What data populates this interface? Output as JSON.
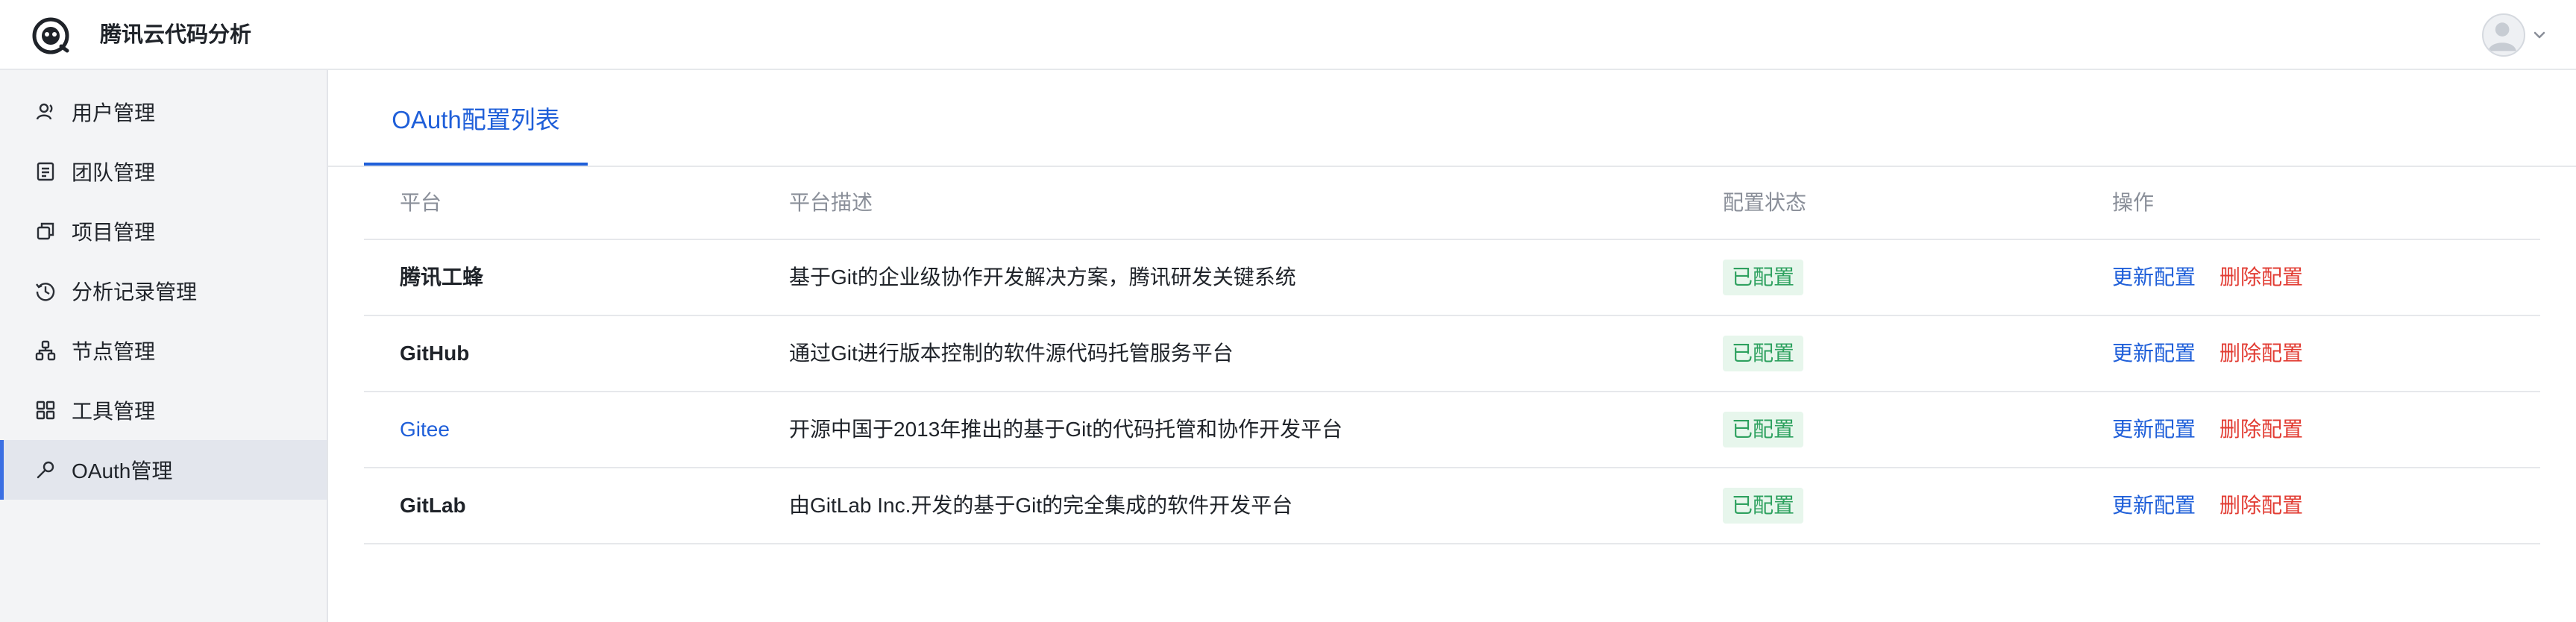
{
  "app": {
    "title": "腾讯云代码分析",
    "brand_color": "#1f5fd9"
  },
  "header": {
    "logo_icon": "cloud-code-logo",
    "avatar_icon": "user-avatar",
    "dropdown_icon": "chevron-down-icon"
  },
  "sidebar": {
    "items": [
      {
        "label": "用户管理",
        "icon": "user-icon",
        "active": false
      },
      {
        "label": "团队管理",
        "icon": "team-icon",
        "active": false
      },
      {
        "label": "项目管理",
        "icon": "project-icon",
        "active": false
      },
      {
        "label": "分析记录管理",
        "icon": "history-icon",
        "active": false
      },
      {
        "label": "节点管理",
        "icon": "node-icon",
        "active": false
      },
      {
        "label": "工具管理",
        "icon": "tools-icon",
        "active": false
      },
      {
        "label": "OAuth管理",
        "icon": "key-icon",
        "active": true
      }
    ]
  },
  "main": {
    "tab_label": "OAuth配置列表",
    "table": {
      "columns": [
        "平台",
        "平台描述",
        "配置状态",
        "操作"
      ],
      "rows": [
        {
          "platform": "腾讯工蜂",
          "description": "基于Git的企业级协作开发解决方案，腾讯研发关键系统",
          "status": "已配置",
          "actions": [
            "更新配置",
            "删除配置"
          ]
        },
        {
          "platform": "GitHub",
          "description": "通过Git进行版本控制的软件源代码托管服务平台",
          "status": "已配置",
          "actions": [
            "更新配置",
            "删除配置"
          ]
        },
        {
          "platform": "Gitee",
          "description": "开源中国于2013年推出的基于Git的代码托管和协作开发平台",
          "status": "已配置",
          "actions": [
            "更新配置",
            "删除配置"
          ]
        },
        {
          "platform": "GitLab",
          "description": "由GitLab Inc.开发的基于Git的完全集成的软件开发平台",
          "status": "已配置",
          "actions": [
            "更新配置",
            "删除配置"
          ]
        }
      ]
    }
  }
}
